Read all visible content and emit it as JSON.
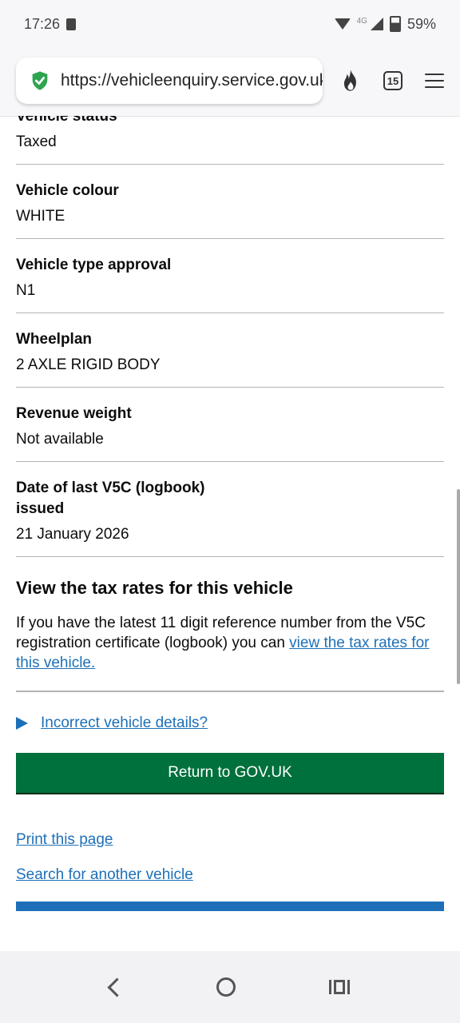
{
  "status_bar": {
    "time": "17:26",
    "network": "4G",
    "battery": "59%"
  },
  "browser": {
    "url": "https://vehicleenquiry.service.gov.uk",
    "tab_count": "15"
  },
  "rows": [
    {
      "title": "Vehicle status",
      "value": "Taxed"
    },
    {
      "title": "Vehicle colour",
      "value": "WHITE"
    },
    {
      "title": "Vehicle type approval",
      "value": "N1"
    },
    {
      "title": "Wheelplan",
      "value": "2 AXLE RIGID BODY"
    },
    {
      "title": "Revenue weight",
      "value": "Not available"
    },
    {
      "title": "Date of last V5C (logbook) issued",
      "value": "21 January 2026"
    }
  ],
  "tax_section": {
    "heading": "View the tax rates for this vehicle",
    "text": "If you have the latest 11 digit reference number from the V5C registration certificate (logbook) you can ",
    "link": "view the tax rates for this vehicle."
  },
  "details_link": "Incorrect vehicle details?",
  "return_button": "Return to GOV.UK",
  "footer_links": {
    "print": "Print this page",
    "search": "Search for another vehicle"
  }
}
